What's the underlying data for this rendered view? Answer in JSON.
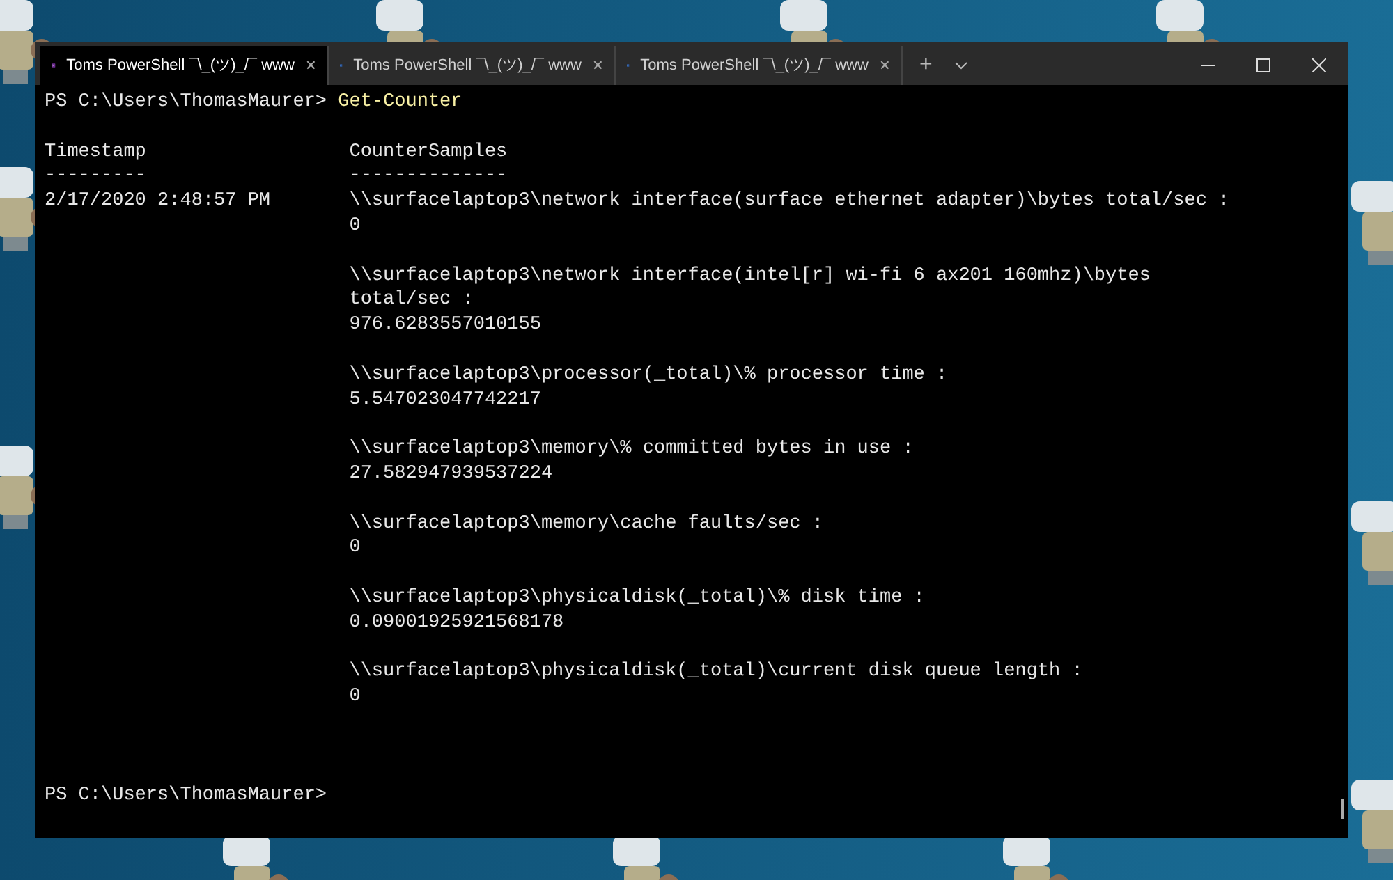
{
  "tabs": [
    {
      "label": "Toms PowerShell ¯\\_(ツ)_/¯ www",
      "selected": true,
      "close": "×"
    },
    {
      "label": "Toms PowerShell ¯\\_(ツ)_/¯ www",
      "selected": false,
      "close": "×"
    },
    {
      "label": "Toms PowerShell ¯\\_(ツ)_/¯ www",
      "selected": false,
      "close": "×"
    }
  ],
  "new_tab": "+",
  "terminal": {
    "prompt": "PS C:\\Users\\ThomasMaurer> ",
    "command": "Get-Counter",
    "headers": [
      "Timestamp",
      "CounterSamples"
    ],
    "underlines": [
      "---------",
      "--------------"
    ],
    "timestamp": "2/17/2020 2:48:57 PM",
    "samples": [
      {
        "path": [
          "\\\\surfacelaptop3\\network interface(surface ethernet adapter)\\bytes total/sec :"
        ],
        "value": "0"
      },
      {
        "path": [
          "\\\\surfacelaptop3\\network interface(intel[r] wi-fi 6 ax201 160mhz)\\bytes",
          "total/sec :"
        ],
        "value": "976.6283557010155"
      },
      {
        "path": [
          "\\\\surfacelaptop3\\processor(_total)\\% processor time :"
        ],
        "value": "5.547023047742217"
      },
      {
        "path": [
          "\\\\surfacelaptop3\\memory\\% committed bytes in use :"
        ],
        "value": "27.582947939537224"
      },
      {
        "path": [
          "\\\\surfacelaptop3\\memory\\cache faults/sec :"
        ],
        "value": "0"
      },
      {
        "path": [
          "\\\\surfacelaptop3\\physicaldisk(_total)\\% disk time :"
        ],
        "value": "0.09001925921568178"
      },
      {
        "path": [
          "\\\\surfacelaptop3\\physicaldisk(_total)\\current disk queue length :"
        ],
        "value": "0"
      }
    ],
    "final_prompt": "PS C:\\Users\\ThomasMaurer>"
  }
}
